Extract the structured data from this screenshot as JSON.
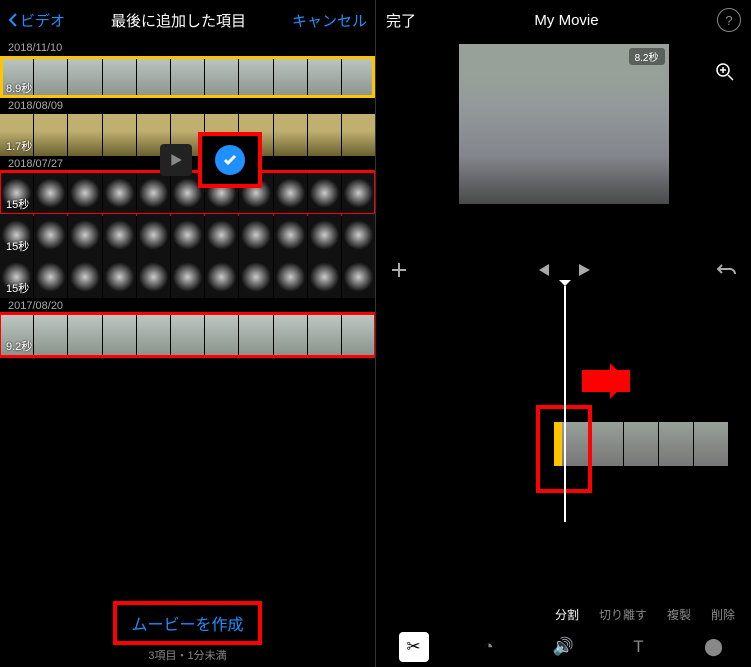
{
  "left": {
    "back": "ビデオ",
    "title": "最後に追加した項目",
    "cancel": "キャンセル",
    "groups": [
      {
        "date": "2018/11/10",
        "items": [
          {
            "dur": "8.9秒",
            "sel": true,
            "cls": "beach"
          }
        ]
      },
      {
        "date": "2018/08/09",
        "items": [
          {
            "dur": "1.7秒",
            "sel": false,
            "cls": "desert"
          }
        ]
      },
      {
        "date": "2018/07/27",
        "items": [
          {
            "dur": "15秒",
            "sel": false,
            "cls": "firework",
            "red": true
          },
          {
            "dur": "15秒",
            "sel": false,
            "cls": "firework"
          },
          {
            "dur": "15秒",
            "sel": false,
            "cls": "firework"
          }
        ]
      },
      {
        "date": "2017/08/20",
        "items": [
          {
            "dur": "9.2秒",
            "sel": false,
            "cls": "beach",
            "red": true
          }
        ]
      }
    ],
    "create": "ムービーを作成",
    "sub": "3項目・1分未満"
  },
  "right": {
    "done": "完了",
    "title": "My Movie",
    "badge": "8.2秒",
    "actions": [
      "分割",
      "切り離す",
      "複製",
      "削除"
    ],
    "tools": [
      "✂",
      "◔",
      "🔊",
      "T",
      "⬤"
    ]
  }
}
